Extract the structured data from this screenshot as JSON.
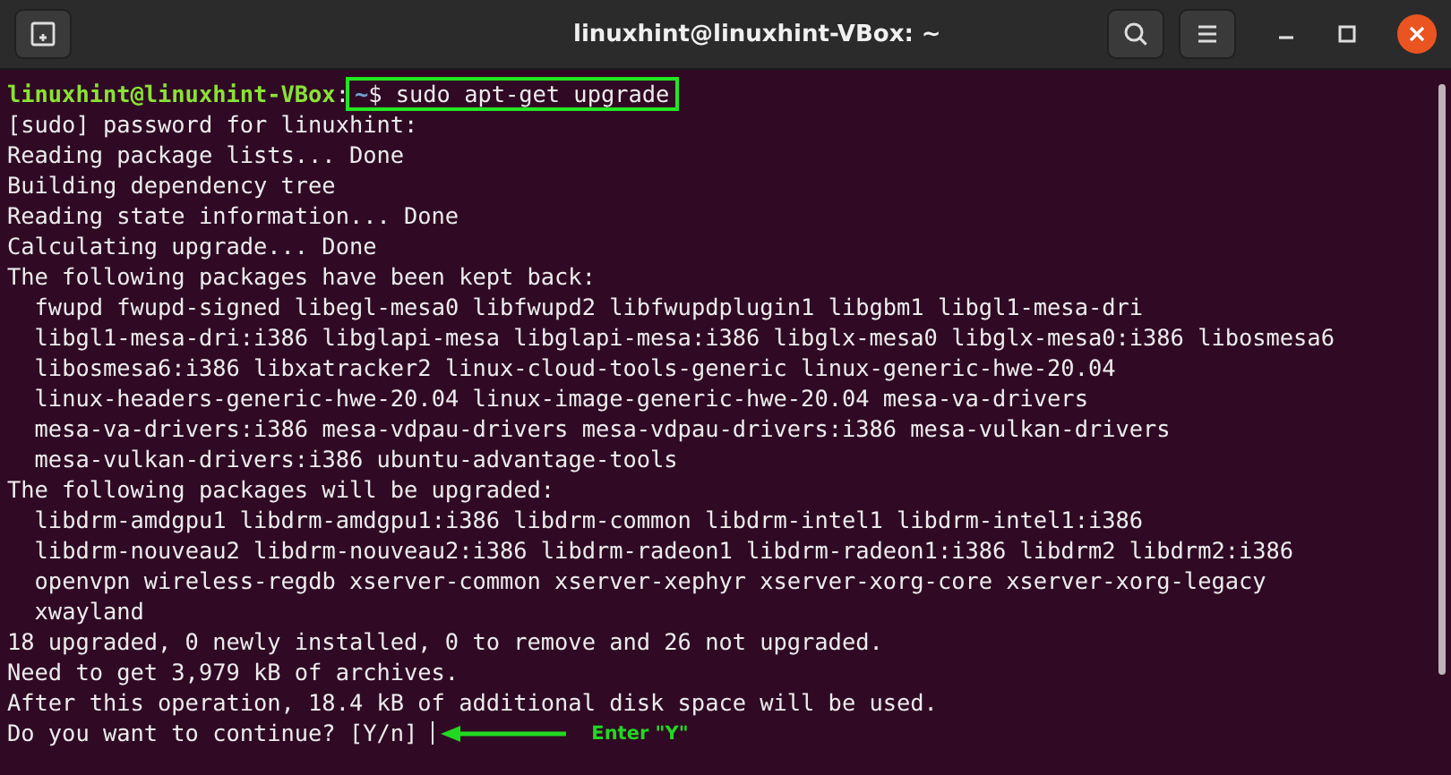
{
  "window": {
    "title": "linuxhint@linuxhint-VBox: ~"
  },
  "prompt": {
    "user_host": "linuxhint@linuxhint-VBox",
    "separator": ":",
    "path": "~",
    "command": "$ sudo apt-get upgrade",
    "highlighted": true
  },
  "lines": [
    {
      "kind": "output",
      "text": "[sudo] password for linuxhint:"
    },
    {
      "kind": "output",
      "text": "Reading package lists... Done"
    },
    {
      "kind": "output",
      "text": "Building dependency tree"
    },
    {
      "kind": "output",
      "text": "Reading state information... Done"
    },
    {
      "kind": "output",
      "text": "Calculating upgrade... Done"
    },
    {
      "kind": "output",
      "text": "The following packages have been kept back:"
    },
    {
      "kind": "package",
      "text": "fwupd fwupd-signed libegl-mesa0 libfwupd2 libfwupdplugin1 libgbm1 libgl1-mesa-dri"
    },
    {
      "kind": "package",
      "text": "libgl1-mesa-dri:i386 libglapi-mesa libglapi-mesa:i386 libglx-mesa0 libglx-mesa0:i386 libosmesa6"
    },
    {
      "kind": "package",
      "text": "libosmesa6:i386 libxatracker2 linux-cloud-tools-generic linux-generic-hwe-20.04"
    },
    {
      "kind": "package",
      "text": "linux-headers-generic-hwe-20.04 linux-image-generic-hwe-20.04 mesa-va-drivers"
    },
    {
      "kind": "package",
      "text": "mesa-va-drivers:i386 mesa-vdpau-drivers mesa-vdpau-drivers:i386 mesa-vulkan-drivers"
    },
    {
      "kind": "package",
      "text": "mesa-vulkan-drivers:i386 ubuntu-advantage-tools"
    },
    {
      "kind": "output",
      "text": "The following packages will be upgraded:"
    },
    {
      "kind": "package",
      "text": "libdrm-amdgpu1 libdrm-amdgpu1:i386 libdrm-common libdrm-intel1 libdrm-intel1:i386"
    },
    {
      "kind": "package",
      "text": "libdrm-nouveau2 libdrm-nouveau2:i386 libdrm-radeon1 libdrm-radeon1:i386 libdrm2 libdrm2:i386"
    },
    {
      "kind": "package",
      "text": "openvpn wireless-regdb xserver-common xserver-xephyr xserver-xorg-core xserver-xorg-legacy"
    },
    {
      "kind": "package",
      "text": "xwayland"
    },
    {
      "kind": "output",
      "text": "18 upgraded, 0 newly installed, 0 to remove and 26 not upgraded."
    },
    {
      "kind": "output",
      "text": "Need to get 3,979 kB of archives."
    },
    {
      "kind": "output",
      "text": "After this operation, 18.4 kB of additional disk space will be used."
    }
  ],
  "question": {
    "text": "Do you want to continue? [Y/n]",
    "annotation": "Enter \"Y\""
  }
}
